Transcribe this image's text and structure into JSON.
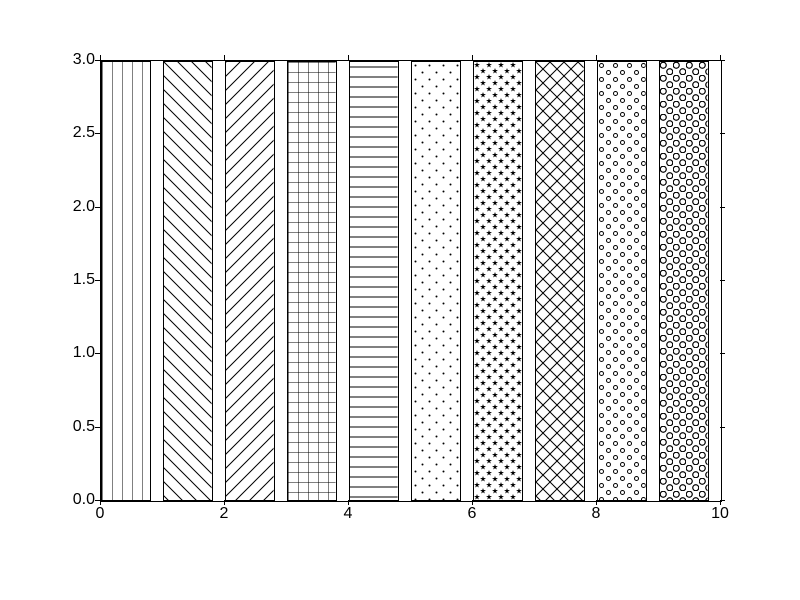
{
  "chart_data": {
    "type": "bar",
    "categories": [
      0,
      1,
      2,
      3,
      4,
      5,
      6,
      7,
      8,
      9
    ],
    "values": [
      3,
      3,
      3,
      3,
      3,
      3,
      3,
      3,
      3,
      3
    ],
    "hatches": [
      "|",
      "\\",
      "/",
      "+",
      "-",
      ".",
      "*",
      "x",
      "o",
      "O"
    ],
    "title": "",
    "xlabel": "",
    "ylabel": "",
    "xlim": [
      0,
      10
    ],
    "ylim": [
      0,
      3
    ],
    "xticks": [
      0,
      2,
      4,
      6,
      8,
      10
    ],
    "yticks": [
      0.0,
      0.5,
      1.0,
      1.5,
      2.0,
      2.5,
      3.0
    ],
    "bar_width": 0.8,
    "xtick_labels": [
      "0",
      "2",
      "4",
      "6",
      "8",
      "10"
    ],
    "ytick_labels": [
      "0.0",
      "0.5",
      "1.0",
      "1.5",
      "2.0",
      "2.5",
      "3.0"
    ]
  }
}
